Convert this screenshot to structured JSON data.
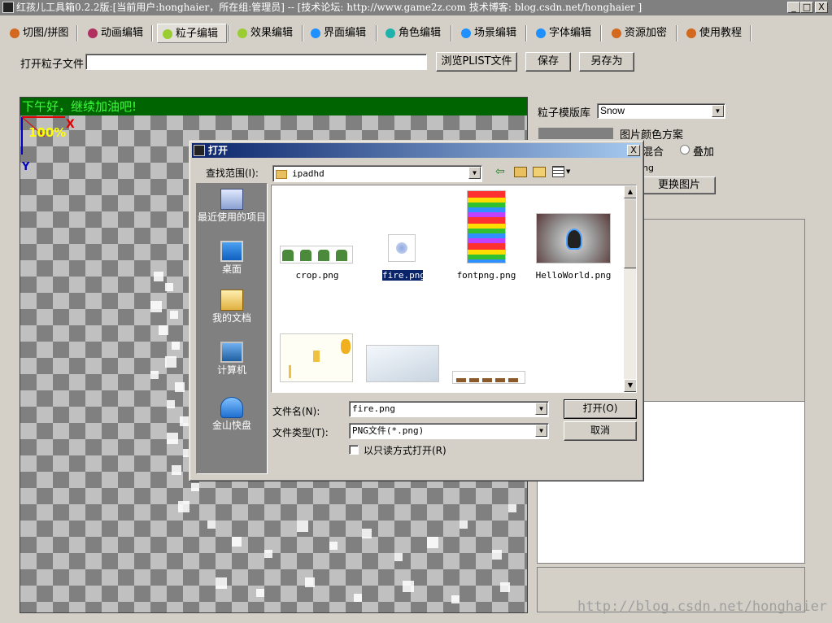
{
  "window": {
    "title": "红孩儿工具箱0.2.2版:[当前用户:honghaier，所在组:管理员]  --  [技术论坛: http://www.game2z.com 技术博客: blog.csdn.net/honghaier ]",
    "min": "_",
    "max": "□",
    "close": "X"
  },
  "toolbar": {
    "tabs": [
      {
        "label": "切图/拼图",
        "color": "#d2691e"
      },
      {
        "label": "动画编辑",
        "color": "#b03060"
      },
      {
        "label": "粒子编辑",
        "color": "#9acd32"
      },
      {
        "label": "效果编辑",
        "color": "#9acd32"
      },
      {
        "label": "界面编辑",
        "color": "#1e90ff"
      },
      {
        "label": "角色编辑",
        "color": "#20b2aa"
      },
      {
        "label": "场景编辑",
        "color": "#1e90ff"
      },
      {
        "label": "字体编辑",
        "color": "#1e90ff"
      },
      {
        "label": "资源加密",
        "color": "#d2691e"
      },
      {
        "label": "使用教程",
        "color": "#d2691e"
      }
    ]
  },
  "particle_file": {
    "label": "打开粒子文件",
    "value": "",
    "browse": "浏览PLIST文件",
    "save": "保存",
    "save_as": "另存为"
  },
  "canvas": {
    "greeting": "下午好，继续加油吧!",
    "zoom": "100%",
    "axis_x": "X",
    "axis_y": "Y"
  },
  "right_panel": {
    "template_label": "粒子模版库",
    "template_value": "Snow",
    "color_scheme": "图片颜色方案",
    "blend_mix": "混合",
    "blend_add": "叠加",
    "image_name": "ng",
    "change_image": "更换图片"
  },
  "dialog": {
    "title": "打开",
    "lookin_label": "查找范围(I):",
    "lookin_value": "ipadhd",
    "places": [
      "最近使用的项目",
      "桌面",
      "我的文档",
      "计算机",
      "金山快盘"
    ],
    "files": [
      "crop.png",
      "fire.png",
      "fontpng.png",
      "HelloWorld.png",
      "",
      "",
      ""
    ],
    "filename_label": "文件名(N):",
    "filename_value": "fire.png",
    "filetype_label": "文件类型(T):",
    "filetype_value": "PNG文件(*.png)",
    "readonly_label": "以只读方式打开(R)",
    "open_btn": "打开(O)",
    "cancel_btn": "取消"
  },
  "watermark": "http://blog.csdn.net/honghaier"
}
